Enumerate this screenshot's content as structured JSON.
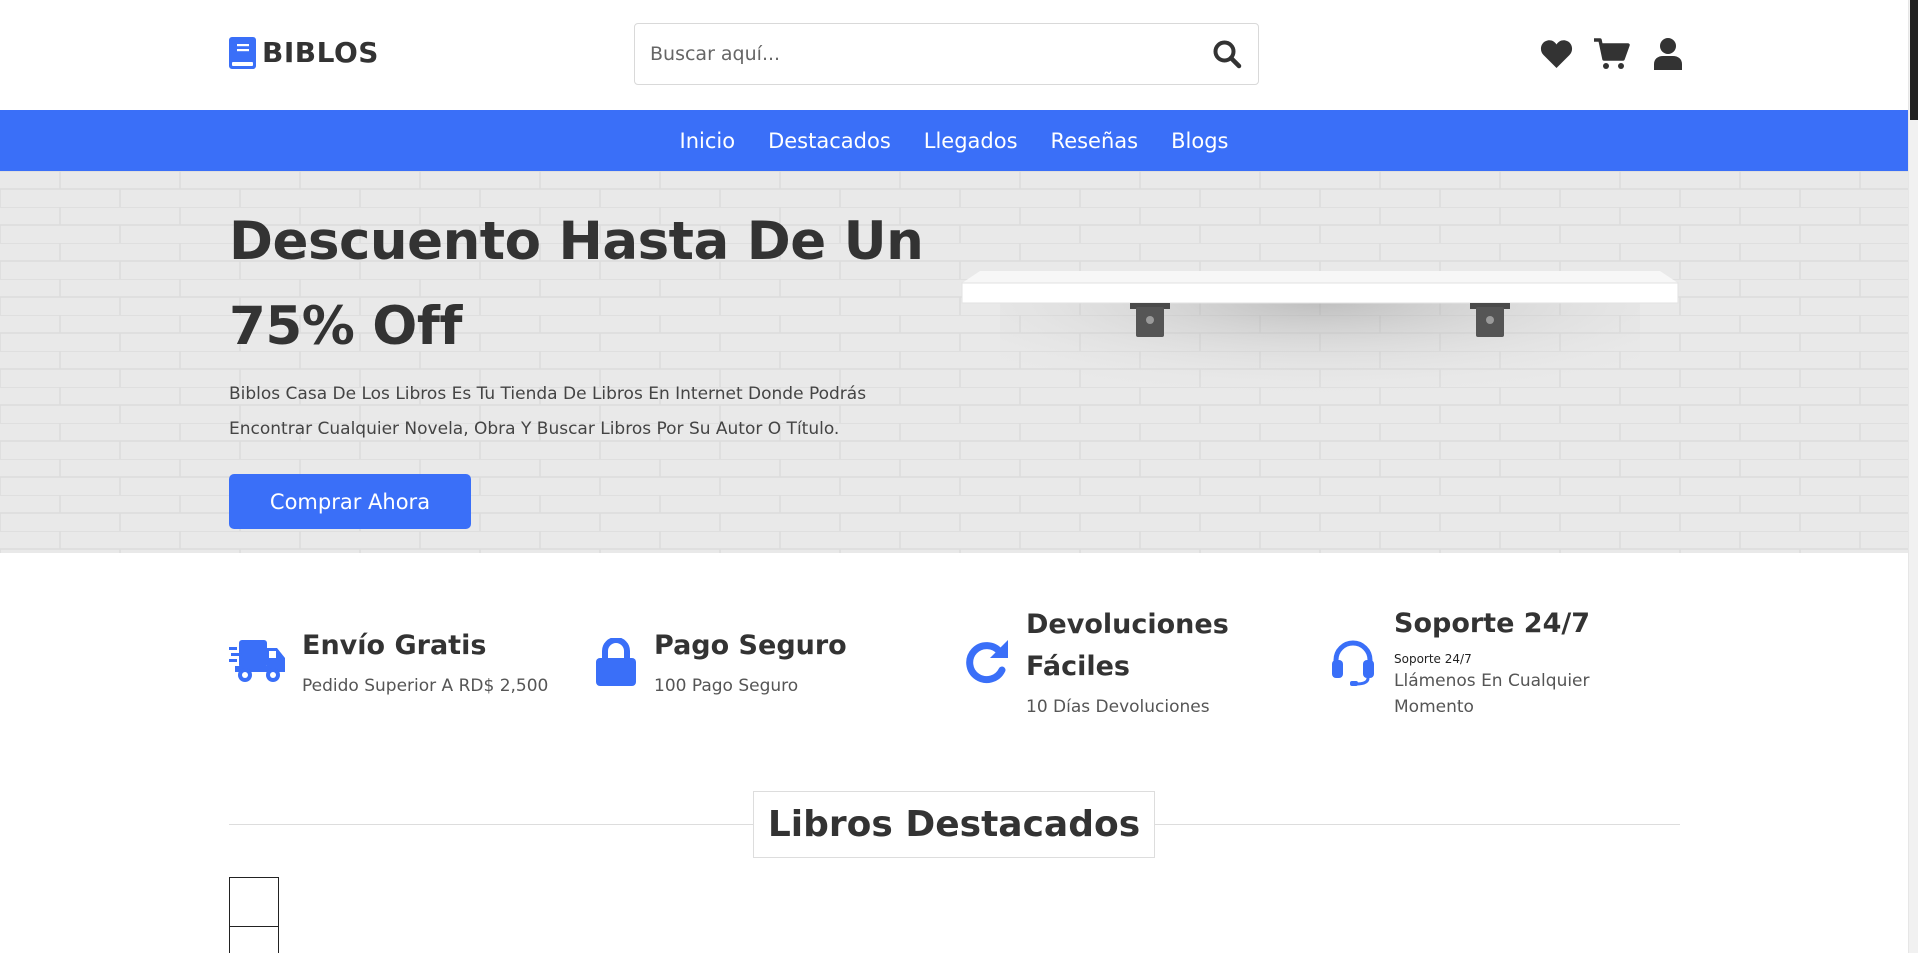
{
  "header": {
    "logo_text": "BIBLOS",
    "search_placeholder": "Buscar aquí..."
  },
  "icons": {
    "logo": "book-icon",
    "search": "search-icon",
    "wishlist": "heart-icon",
    "cart": "cart-icon",
    "account": "user-icon"
  },
  "nav": {
    "items": [
      "Inicio",
      "Destacados",
      "Llegados",
      "Reseñas",
      "Blogs"
    ]
  },
  "hero": {
    "title": "Descuento Hasta De Un 75% Off",
    "description": "Biblos Casa De Los Libros Es Tu Tienda De Libros En Internet Donde Podrás Encontrar Cualquier Novela, Obra Y Buscar Libros Por Su Autor O Título.",
    "button_label": "Comprar Ahora"
  },
  "features": [
    {
      "icon": "truck-icon",
      "title": "Envío Gratis",
      "subtitle": "Pedido Superior A RD$ 2,500"
    },
    {
      "icon": "lock-icon",
      "title": "Pago Seguro",
      "subtitle": "100 Pago Seguro"
    },
    {
      "icon": "redo-icon",
      "title": "Devoluciones Fáciles",
      "subtitle": "10 Días Devoluciones"
    },
    {
      "icon": "headset-icon",
      "title": "Soporte 24/7",
      "small": "Soporte 24/7",
      "subtitle": "Llámenos En Cualquier Momento"
    }
  ],
  "featured_section": {
    "title": "Libros Destacados"
  },
  "colors": {
    "accent": "#3a6ff8",
    "text": "#333333",
    "hero_bg": "#e8e8e8"
  }
}
